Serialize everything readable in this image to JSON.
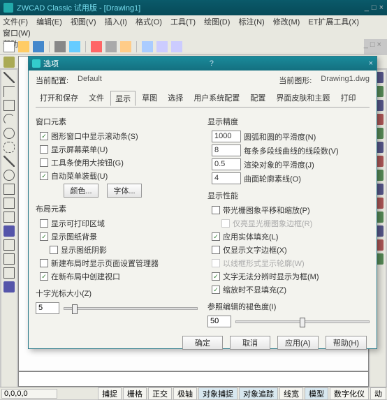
{
  "app": {
    "title": "ZWCAD Classic 试用版 - [Drawing1]"
  },
  "menu": {
    "items": [
      "文件(F)",
      "编辑(E)",
      "视图(V)",
      "插入(I)",
      "格式(O)",
      "工具(T)",
      "绘图(D)",
      "标注(N)",
      "修改(M)",
      "ET扩展工具(X)",
      "窗口(W)",
      "帮助(H)"
    ]
  },
  "statusbar": {
    "coord": "0,0,0,0",
    "buttons": [
      "捕捉",
      "栅格",
      "正交",
      "极轴",
      "对象捕捉",
      "对象追踪",
      "线宽",
      "模型",
      "数字化仪",
      "动"
    ]
  },
  "dialog": {
    "title": "选项",
    "profile_label": "当前配置:",
    "profile_value": "Default",
    "drawing_label": "当前图形:",
    "drawing_value": "Drawing1.dwg",
    "tabs": [
      "打开和保存",
      "文件",
      "显示",
      "草图",
      "选择",
      "用户系统配置",
      "配置",
      "界面皮肤和主题",
      "打印"
    ],
    "active_tab": "显示",
    "window_elements": {
      "title": "窗口元素",
      "scrollbar": "图形窗口中显示滚动条(S)",
      "screenmenu": "显示屏幕菜单(U)",
      "largebtn": "工具条使用大按钮(G)",
      "automenu": "自动菜单装载(U)",
      "color_btn": "颜色...",
      "font_btn": "字体..."
    },
    "layout_elements": {
      "title": "布局元素",
      "printable": "显示可打印区域",
      "paperbg": "显示图纸背景",
      "papershadow": "显示图纸阴影",
      "pagesetup": "新建布局时显示页面设置管理器",
      "viewport": "在新布局中创建视口"
    },
    "crosshair": {
      "title": "十字光标大小(Z)",
      "value": "5"
    },
    "display_precision": {
      "title": "显示精度",
      "arc_smooth_val": "1000",
      "arc_smooth": "圆弧和圆的平滑度(N)",
      "seg_val": "8",
      "seg": "每条多段线曲线的线段数(V)",
      "render_val": "0.5",
      "render": "渲染对象的平滑度(J)",
      "contour_val": "4",
      "contour": "曲面轮廓素线(O)"
    },
    "display_performance": {
      "title": "显示性能",
      "pan_raster": "带光栅图象平移和缩放(P)",
      "highlight_frame": "仅亮显光栅图象边框(R)",
      "solid_fill": "应用实体填充(L)",
      "text_frame": "仅显示文字边框(X)",
      "wireframe": "以线框形式显示轮廓(W)",
      "micro_text": "文字无法分辨时显示为框(M)",
      "zoom_nofill": "缩放时不显填充(Z)"
    },
    "fade": {
      "title": "参照编辑的褪色度(I)",
      "value": "50"
    },
    "buttons": {
      "ok": "确定",
      "cancel": "取消",
      "apply": "应用(A)",
      "help": "帮助(H)"
    }
  }
}
